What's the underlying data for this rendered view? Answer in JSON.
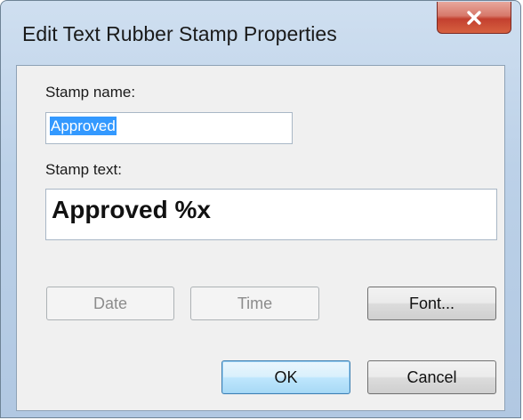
{
  "window": {
    "title": "Edit Text Rubber Stamp Properties",
    "close_icon": "close-icon"
  },
  "stamp_name": {
    "label": "Stamp name:",
    "value": "Approved"
  },
  "stamp_text": {
    "label": "Stamp text:",
    "value": "Approved %x"
  },
  "buttons": {
    "date": "Date",
    "time": "Time",
    "font": "Font...",
    "ok": "OK",
    "cancel": "Cancel"
  },
  "colors": {
    "selection": "#3399ff",
    "close_button": "#c3402f",
    "default_button_border": "#3c7fb1"
  }
}
